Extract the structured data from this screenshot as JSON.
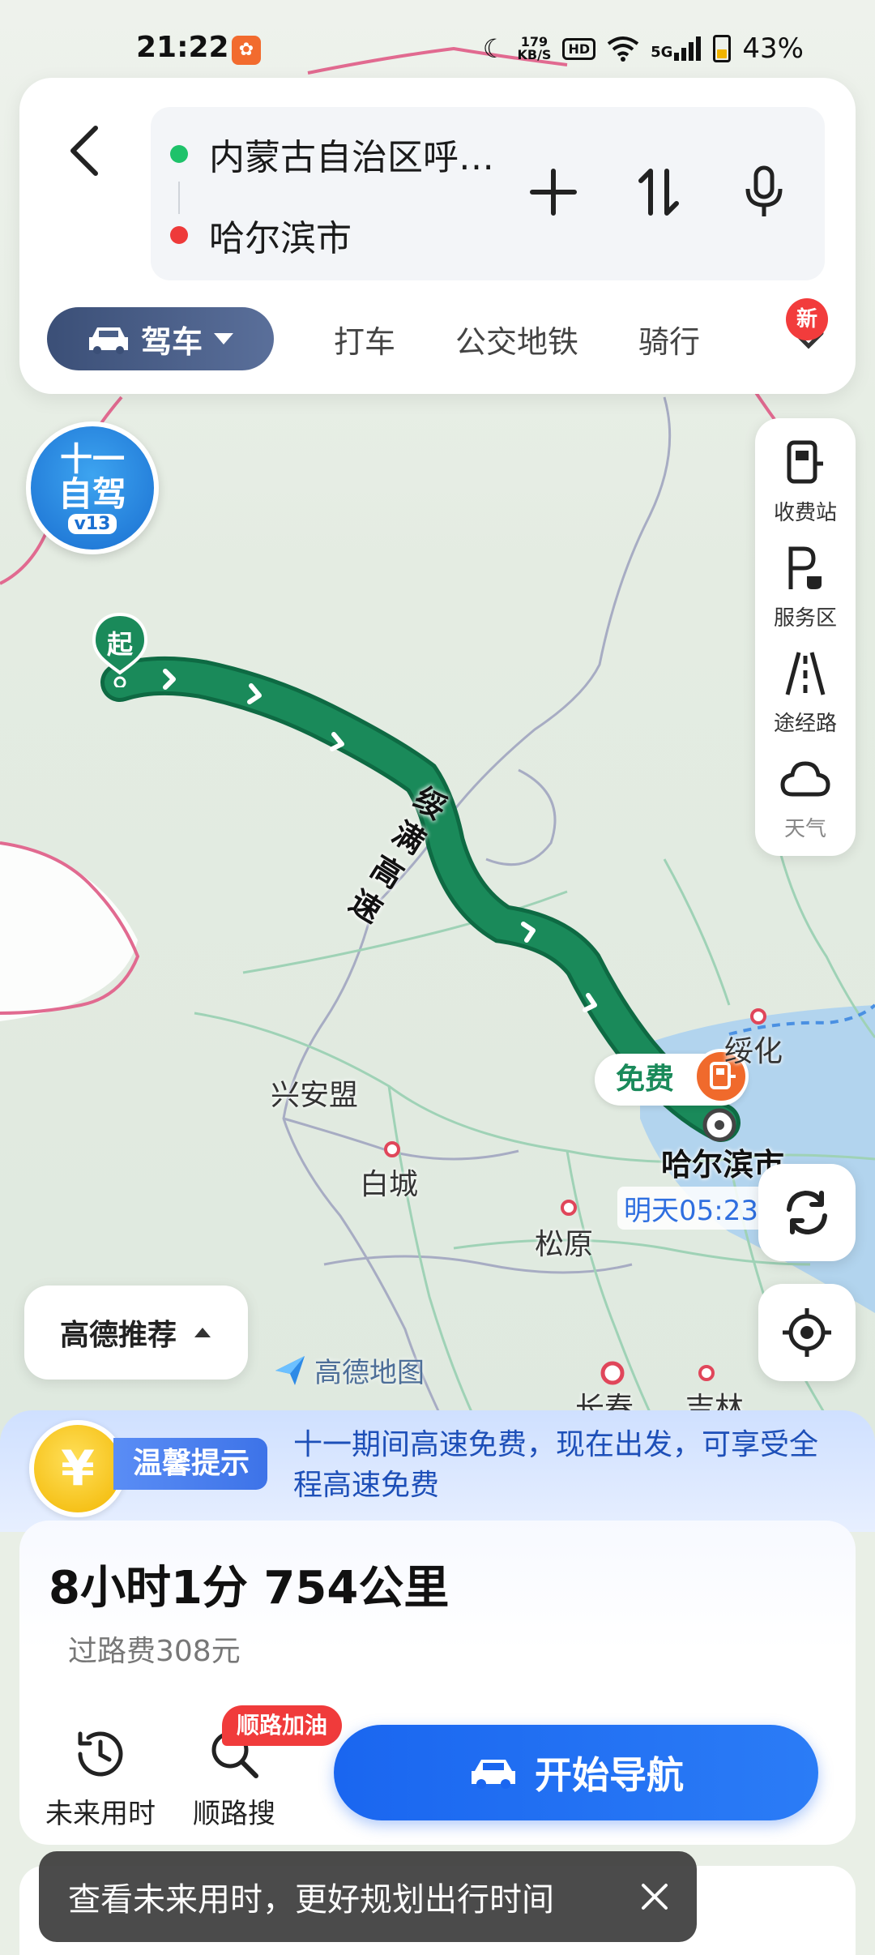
{
  "status_bar": {
    "time": "21:22",
    "net_speed_top": "179",
    "net_speed_bottom": "KB/S",
    "hd": "HD",
    "signal": "5G",
    "battery": "43%"
  },
  "route": {
    "from": "内蒙古自治区呼…",
    "to": "哈尔滨市"
  },
  "modes": {
    "active": "驾车",
    "items": [
      "打车",
      "公交地铁",
      "骑行"
    ],
    "new_badge": "新"
  },
  "promo": {
    "line1": "十一",
    "line2": "自驾",
    "line3": "v13"
  },
  "tools": [
    {
      "label": "收费站",
      "icon": "toll-station-icon"
    },
    {
      "label": "服务区",
      "icon": "service-area-icon"
    },
    {
      "label": "途经路",
      "icon": "via-road-icon"
    },
    {
      "label": "天气",
      "icon": "weather-icon"
    }
  ],
  "map": {
    "start_label": "起",
    "road_name": "绥满高速",
    "toll_free": "免费",
    "destination": "哈尔滨市",
    "eta": "明天05:23",
    "places": [
      "兴安盟",
      "白城",
      "松原",
      "绥化",
      "长春",
      "吉林"
    ],
    "logo": "高德地图"
  },
  "recommend": {
    "label": "高德推荐"
  },
  "tip": {
    "label": "温馨提示",
    "text": "十一期间高速免费，现在出发，可享受全程高速免费",
    "coin": "¥"
  },
  "summary": {
    "duration_distance": "8小时1分  754公里",
    "toll": "过路费308元"
  },
  "actions": {
    "future_time": "未来用时",
    "along_search": "顺路搜",
    "along_badge": "顺路加油",
    "start_nav": "开始导航"
  },
  "toast": {
    "text": "查看未来用时，更好规划出行时间"
  },
  "colors": {
    "route_green": "#1a8a5a",
    "accent_blue": "#1a66f0",
    "tip_blue": "#1d4fb8",
    "badge_red": "#f03b3b"
  }
}
